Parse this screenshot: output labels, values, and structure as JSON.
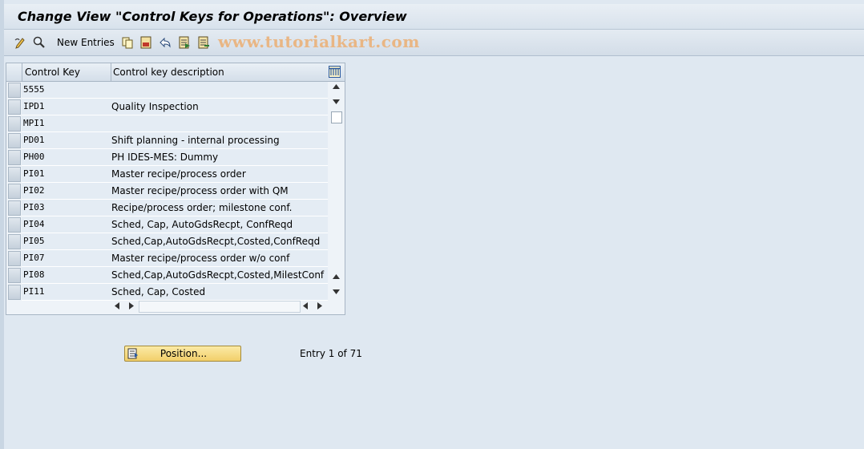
{
  "window": {
    "title": "Change View \"Control Keys for Operations\": Overview"
  },
  "toolbar": {
    "new_entries_label": "New Entries",
    "watermark": "www.tutorialkart.com",
    "icons": [
      "display-change-icon",
      "details-icon",
      "copy-icon",
      "delete-icon",
      "undo-icon",
      "select-all-icon",
      "deselect-all-icon"
    ]
  },
  "table": {
    "headers": [
      "Control Key",
      "Control key description"
    ],
    "rows": [
      {
        "key": "5555",
        "desc": ""
      },
      {
        "key": "IPD1",
        "desc": "Quality Inspection"
      },
      {
        "key": "MPI1",
        "desc": ""
      },
      {
        "key": "PD01",
        "desc": "Shift planning - internal processing"
      },
      {
        "key": "PH00",
        "desc": "PH IDES-MES: Dummy"
      },
      {
        "key": "PI01",
        "desc": "Master recipe/process order"
      },
      {
        "key": "PI02",
        "desc": "Master recipe/process order with QM"
      },
      {
        "key": "PI03",
        "desc": "Recipe/process order; milestone conf."
      },
      {
        "key": "PI04",
        "desc": "Sched, Cap, AutoGdsRecpt, ConfReqd"
      },
      {
        "key": "PI05",
        "desc": "Sched,Cap,AutoGdsRecpt,Costed,ConfReqd"
      },
      {
        "key": "PI07",
        "desc": "Master recipe/process order w/o conf"
      },
      {
        "key": "PI08",
        "desc": "Sched,Cap,AutoGdsRecpt,Costed,MilestConf"
      },
      {
        "key": "PI11",
        "desc": "Sched, Cap, Costed"
      }
    ]
  },
  "footer": {
    "position_button_label": "Position...",
    "entry_text": "Entry 1 of 71"
  },
  "colors": {
    "background": "#dfe8f1",
    "cell": "#e4ecf4",
    "button": "#f2cf6a",
    "watermark": "#e9b684"
  }
}
